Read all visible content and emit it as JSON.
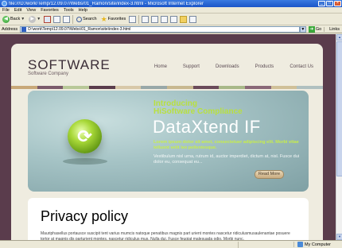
{
  "window": {
    "title": "file:///D:/work/Temp/12.09.07/Webs/01_Ramon/site/index-3.html - Microsoft Internet Explorer",
    "min": "_",
    "max": "□",
    "close": "×"
  },
  "menu": [
    "File",
    "Edit",
    "View",
    "Favorites",
    "Tools",
    "Help"
  ],
  "toolbar": {
    "back": "Back",
    "search": "Search",
    "favorites": "Favorites"
  },
  "address": {
    "label": "Address",
    "url": "D:\\work\\Temp\\12.09.07\\Webs\\01_Ramon\\site\\index-3.html",
    "go": "Go",
    "links": "Links"
  },
  "site": {
    "logo": "SOFTWARE",
    "tagline": "Software Company",
    "nav": [
      "Home",
      "Support",
      "Downloads",
      "Products",
      "Contact Us"
    ],
    "stripes": [
      "#c8a878",
      "#7a5a6a",
      "#b8c898",
      "#5a3c4c",
      "#d8c8a8",
      "#98a8a8",
      "#c8b890",
      "#6a4a5a",
      "#a8b888",
      "#8a6878",
      "#d0c098",
      "#b0c0c0"
    ],
    "banner": {
      "intro1": "Introducing",
      "intro2": "HiSoftware Compliance",
      "headline": "DataXtend IF",
      "lead": "Lorem ipsum dolor sit amet, consectetuer adipiscing elit. Morbi vitae tellusnt velit leo pellentesque.",
      "body": "Vestibulum nisl urna, rutrum id, auctor imperdiet, dictum at, nisl. Fusce dui dolor eu, consequat eu...",
      "read_more": "Read More"
    },
    "privacy": {
      "title": "Privacy policy",
      "text": "Mauriphasellus portausce suscipit tent varius mumcis natoque penatibus magnis part urient montes nascetur ridiculusmusaulenantae posuere tortor at magnis dis parturient montes, nascetur ridiculus mus. Nulla dui. Fusce feugiat malesuada odio. Morbi nunc."
    }
  },
  "status": {
    "zone": "My Computer"
  }
}
